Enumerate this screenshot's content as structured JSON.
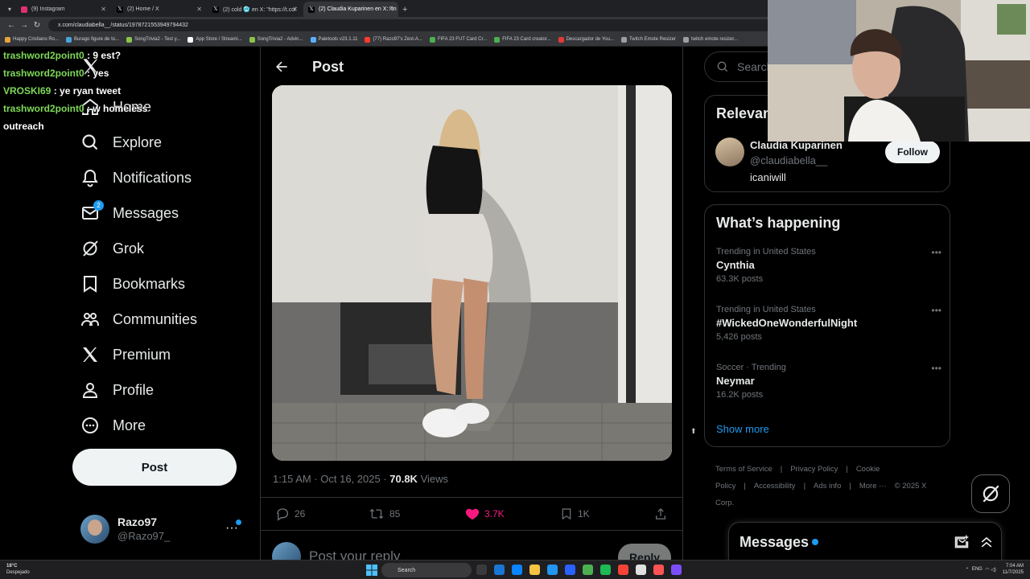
{
  "browser": {
    "tabs": [
      {
        "title": "(9) Instagram",
        "color": "#e1306c",
        "active": false
      },
      {
        "title": "(2) Home / X",
        "color": "#ffffff",
        "active": false
      },
      {
        "title": "(2) cold 🥶 en X: \"https://t.co/",
        "color": "#ffffff",
        "active": false
      },
      {
        "title": "(2) Claudia Kuparinen en X: \"In",
        "color": "#ffffff",
        "active": true
      }
    ],
    "url": "x.com/claudiabella__/status/1978721553949794432",
    "bookmarks": [
      "Happy Cristiano Ro...",
      "Burago figure de to...",
      "SongTrivia2 - Test y...",
      "App Store / Streami...",
      "SongTrivia2 - Advin...",
      "Paletools v23.1.11",
      "(77) Razo97's Zest-A...",
      "FIFA 23 FUT Card Cr...",
      "FIFA 23 Card creator...",
      "Descargador de You...",
      "Twitch Emote Resizer",
      "twitch emote resizer..."
    ]
  },
  "chat": [
    {
      "user": "trashword2point0",
      "message": " : 9 est?"
    },
    {
      "user": "trashword2point0",
      "message": " : yes"
    },
    {
      "user": "VROSKI69",
      "message": " : ye ryan tweet"
    },
    {
      "user": "trashword2point0",
      "message": " : w homeless"
    },
    {
      "user": "",
      "message": "outreach"
    }
  ],
  "sidebar": {
    "items": [
      {
        "label": "Home",
        "icon": "home-icon"
      },
      {
        "label": "Explore",
        "icon": "search-icon"
      },
      {
        "label": "Notifications",
        "icon": "bell-icon"
      },
      {
        "label": "Messages",
        "icon": "envelope-icon",
        "badge": "2"
      },
      {
        "label": "Grok",
        "icon": "grok-icon"
      },
      {
        "label": "Bookmarks",
        "icon": "bookmark-icon"
      },
      {
        "label": "Communities",
        "icon": "communities-icon"
      },
      {
        "label": "Premium",
        "icon": "x-logo-icon"
      },
      {
        "label": "Profile",
        "icon": "person-icon"
      },
      {
        "label": "More",
        "icon": "more-circle-icon"
      }
    ],
    "post_label": "Post",
    "account": {
      "name": "Razo97",
      "handle": "@Razo97_",
      "more": "···"
    }
  },
  "post": {
    "header_title": "Post",
    "time": "1:15 AM · Oct 16, 2025 · ",
    "views_count": "70.8K",
    "views_label": " Views",
    "replies": "26",
    "reposts": "85",
    "likes": "3.7K",
    "bookmarks": "1K",
    "reply_placeholder": "Post your reply",
    "reply_button": "Reply",
    "like_color": "#f91880"
  },
  "right": {
    "search_placeholder": "Search",
    "relevant_title": "Relevant people",
    "person": {
      "name": "Claudia Kuparinen",
      "handle": "@claudiabella__",
      "bio": "icaniwill",
      "follow_label": "Follow"
    },
    "happening_title": "What’s happening",
    "trends": [
      {
        "context": "Trending in United States",
        "name": "Cynthia",
        "count": "63.3K posts"
      },
      {
        "context": "Trending in United States",
        "name": "#WickedOneWonderfulNight",
        "count": "5,426 posts"
      },
      {
        "context": "Soccer · Trending",
        "name": "Neymar",
        "count": "16.2K posts"
      }
    ],
    "show_more": "Show more",
    "footer": [
      "Terms of Service",
      "|",
      "Privacy Policy",
      "|",
      "Cookie Policy",
      "|",
      "Accessibility",
      "|",
      "Ads info",
      "|",
      "More ···",
      "© 2025 X Corp."
    ]
  },
  "messages_drawer": {
    "title": "Messages"
  },
  "taskbar": {
    "temp": "18°C",
    "weather": "Despejado",
    "search": "Search",
    "lang": "ENG",
    "time": "7:04 AM",
    "date": "11/7/2025"
  },
  "colors": {
    "accent": "#1d9bf0",
    "chat_user": "#7ed957",
    "bg": "#000000"
  }
}
